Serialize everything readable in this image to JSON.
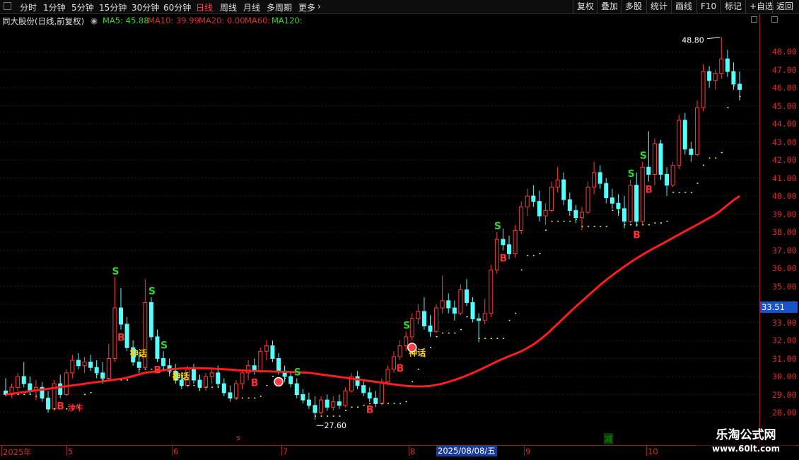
{
  "toolbar": {
    "periods": [
      "分时",
      "1分钟",
      "5分钟",
      "15分钟",
      "30分钟",
      "60分钟",
      "日线",
      "周线",
      "月线",
      "多周期",
      "更多"
    ],
    "active_period": "日线",
    "tools": [
      "复权",
      "叠加",
      "多股",
      "统计",
      "画线",
      "F10",
      "标记",
      "+自选",
      "返回"
    ]
  },
  "info": {
    "stock": "同大股份(日线,前复权)",
    "ma": [
      {
        "label": "MA5: 45.88",
        "color": "#2fd42f"
      },
      {
        "label": "MA10: 39.99",
        "color": "#dd2b2b"
      },
      {
        "label": "MA20: 0.00",
        "color": "#dd2b2b"
      },
      {
        "label": "MA60:",
        "color": "#dd2b2b"
      },
      {
        "label": "MA120:",
        "color": "#2fd42f"
      }
    ]
  },
  "price_tag": "33.51",
  "dates": {
    "ticks": [
      {
        "label": "2025年",
        "x": 4
      },
      {
        "label": "5",
        "x": 96
      },
      {
        "label": "6",
        "x": 245
      },
      {
        "label": "7",
        "x": 400
      },
      {
        "label": "8",
        "x": 580
      },
      {
        "label": "9",
        "x": 743
      },
      {
        "label": "10",
        "x": 916
      }
    ],
    "cursor": "2025/08/08/五",
    "marker_s": "s",
    "marker_jian": "减"
  },
  "watermark": {
    "line1": "乐淘公式网",
    "line2": "www.60lt.com"
  },
  "colors": {
    "up": "#ff3b3b",
    "down": "#54ffff",
    "ma_line": "#ff1c1c",
    "dots": "#ffff40",
    "buy": "#ff3030",
    "sell": "#2fd42f",
    "myth": "#ffd400"
  },
  "chart_data": {
    "type": "candlestick",
    "ylim": [
      27.5,
      49.0
    ],
    "yticks": [
      28,
      29,
      30,
      31,
      32,
      33,
      34,
      35,
      36,
      37,
      38,
      39,
      40,
      41,
      42,
      43,
      44,
      45,
      46,
      47,
      48
    ],
    "annotations": {
      "high_label": "48.80",
      "low_label": "27.60",
      "buy_label": "B",
      "sell_label": "S",
      "myth_label": "神话",
      "ref_label": "涉牛"
    },
    "candles": [
      {
        "o": 29.2,
        "h": 29.9,
        "l": 28.9,
        "c": 29.0
      },
      {
        "o": 29.0,
        "h": 29.6,
        "l": 28.8,
        "c": 29.4
      },
      {
        "o": 29.4,
        "h": 30.2,
        "l": 29.2,
        "c": 30.0
      },
      {
        "o": 30.0,
        "h": 30.8,
        "l": 29.4,
        "c": 29.6
      },
      {
        "o": 29.6,
        "h": 30.0,
        "l": 29.0,
        "c": 29.2
      },
      {
        "o": 29.2,
        "h": 29.8,
        "l": 28.7,
        "c": 29.4
      },
      {
        "o": 29.4,
        "h": 29.7,
        "l": 28.6,
        "c": 28.8
      },
      {
        "o": 28.8,
        "h": 29.2,
        "l": 28.0,
        "c": 28.2
      },
      {
        "o": 28.2,
        "h": 29.8,
        "l": 28.1,
        "c": 29.6
      },
      {
        "o": 29.6,
        "h": 30.1,
        "l": 28.8,
        "c": 29.0
      },
      {
        "o": 29.0,
        "h": 30.4,
        "l": 28.9,
        "c": 30.2
      },
      {
        "o": 30.2,
        "h": 31.2,
        "l": 29.9,
        "c": 30.9
      },
      {
        "o": 30.9,
        "h": 31.3,
        "l": 30.4,
        "c": 30.6
      },
      {
        "o": 30.6,
        "h": 31.1,
        "l": 30.2,
        "c": 30.8
      },
      {
        "o": 30.8,
        "h": 31.2,
        "l": 30.3,
        "c": 30.5
      },
      {
        "o": 30.5,
        "h": 30.9,
        "l": 29.9,
        "c": 30.2
      },
      {
        "o": 30.2,
        "h": 30.8,
        "l": 29.6,
        "c": 29.9
      },
      {
        "o": 29.9,
        "h": 31.8,
        "l": 29.8,
        "c": 31.0
      },
      {
        "o": 31.0,
        "h": 35.5,
        "l": 30.8,
        "c": 33.8
      },
      {
        "o": 33.8,
        "h": 34.9,
        "l": 32.6,
        "c": 32.9
      },
      {
        "o": 32.9,
        "h": 33.3,
        "l": 31.4,
        "c": 31.6
      },
      {
        "o": 31.6,
        "h": 32.0,
        "l": 30.6,
        "c": 30.8
      },
      {
        "o": 30.8,
        "h": 31.3,
        "l": 30.2,
        "c": 30.5
      },
      {
        "o": 30.5,
        "h": 35.4,
        "l": 30.4,
        "c": 34.1
      },
      {
        "o": 34.1,
        "h": 34.4,
        "l": 32.0,
        "c": 32.2
      },
      {
        "o": 32.2,
        "h": 32.6,
        "l": 30.8,
        "c": 31.0
      },
      {
        "o": 31.0,
        "h": 31.4,
        "l": 30.3,
        "c": 30.6
      },
      {
        "o": 30.6,
        "h": 31.0,
        "l": 30.0,
        "c": 30.3
      },
      {
        "o": 30.3,
        "h": 30.7,
        "l": 29.6,
        "c": 29.8
      },
      {
        "o": 29.8,
        "h": 30.2,
        "l": 29.3,
        "c": 29.5
      },
      {
        "o": 29.5,
        "h": 30.6,
        "l": 29.4,
        "c": 30.4
      },
      {
        "o": 30.4,
        "h": 30.7,
        "l": 29.6,
        "c": 29.8
      },
      {
        "o": 29.8,
        "h": 30.1,
        "l": 29.2,
        "c": 29.4
      },
      {
        "o": 29.4,
        "h": 30.2,
        "l": 29.2,
        "c": 30.0
      },
      {
        "o": 30.0,
        "h": 30.5,
        "l": 29.6,
        "c": 30.2
      },
      {
        "o": 30.2,
        "h": 30.6,
        "l": 29.4,
        "c": 29.6
      },
      {
        "o": 29.6,
        "h": 29.9,
        "l": 28.9,
        "c": 29.1
      },
      {
        "o": 29.1,
        "h": 29.5,
        "l": 28.6,
        "c": 28.8
      },
      {
        "o": 28.8,
        "h": 29.8,
        "l": 28.7,
        "c": 29.6
      },
      {
        "o": 29.6,
        "h": 30.4,
        "l": 29.3,
        "c": 30.2
      },
      {
        "o": 30.2,
        "h": 30.9,
        "l": 29.8,
        "c": 30.6
      },
      {
        "o": 30.6,
        "h": 31.0,
        "l": 30.1,
        "c": 30.3
      },
      {
        "o": 30.3,
        "h": 31.6,
        "l": 30.2,
        "c": 31.4
      },
      {
        "o": 31.4,
        "h": 32.0,
        "l": 30.9,
        "c": 31.7
      },
      {
        "o": 31.7,
        "h": 32.0,
        "l": 30.8,
        "c": 31.0
      },
      {
        "o": 31.0,
        "h": 31.3,
        "l": 30.1,
        "c": 30.3
      },
      {
        "o": 30.3,
        "h": 30.6,
        "l": 29.7,
        "c": 30.0
      },
      {
        "o": 30.0,
        "h": 30.3,
        "l": 29.4,
        "c": 29.6
      },
      {
        "o": 29.6,
        "h": 29.9,
        "l": 28.8,
        "c": 29.0
      },
      {
        "o": 29.0,
        "h": 29.3,
        "l": 28.5,
        "c": 28.7
      },
      {
        "o": 28.7,
        "h": 29.1,
        "l": 28.2,
        "c": 28.4
      },
      {
        "o": 28.4,
        "h": 28.9,
        "l": 27.6,
        "c": 28.0
      },
      {
        "o": 28.0,
        "h": 28.9,
        "l": 27.9,
        "c": 28.7
      },
      {
        "o": 28.7,
        "h": 29.0,
        "l": 28.1,
        "c": 28.3
      },
      {
        "o": 28.3,
        "h": 28.9,
        "l": 28.1,
        "c": 28.6
      },
      {
        "o": 28.6,
        "h": 29.0,
        "l": 28.2,
        "c": 28.4
      },
      {
        "o": 28.4,
        "h": 29.4,
        "l": 28.3,
        "c": 29.2
      },
      {
        "o": 29.2,
        "h": 30.2,
        "l": 29.1,
        "c": 30.0
      },
      {
        "o": 30.0,
        "h": 30.3,
        "l": 29.3,
        "c": 29.5
      },
      {
        "o": 29.5,
        "h": 29.8,
        "l": 28.9,
        "c": 29.1
      },
      {
        "o": 29.1,
        "h": 29.4,
        "l": 28.6,
        "c": 28.8
      },
      {
        "o": 28.8,
        "h": 29.2,
        "l": 28.3,
        "c": 28.5
      },
      {
        "o": 28.5,
        "h": 29.9,
        "l": 28.4,
        "c": 29.7
      },
      {
        "o": 29.7,
        "h": 30.6,
        "l": 29.5,
        "c": 30.4
      },
      {
        "o": 30.4,
        "h": 31.4,
        "l": 30.2,
        "c": 31.1
      },
      {
        "o": 31.1,
        "h": 32.0,
        "l": 30.9,
        "c": 31.7
      },
      {
        "o": 31.7,
        "h": 32.5,
        "l": 31.4,
        "c": 32.2
      },
      {
        "o": 32.2,
        "h": 33.5,
        "l": 32.0,
        "c": 33.2
      },
      {
        "o": 33.2,
        "h": 34.0,
        "l": 32.9,
        "c": 33.6
      },
      {
        "o": 33.6,
        "h": 34.4,
        "l": 32.6,
        "c": 32.8
      },
      {
        "o": 32.8,
        "h": 33.4,
        "l": 32.2,
        "c": 32.5
      },
      {
        "o": 32.5,
        "h": 34.0,
        "l": 32.4,
        "c": 33.8
      },
      {
        "o": 33.8,
        "h": 35.6,
        "l": 33.5,
        "c": 34.2
      },
      {
        "o": 34.2,
        "h": 34.6,
        "l": 33.5,
        "c": 33.8
      },
      {
        "o": 33.8,
        "h": 34.2,
        "l": 33.1,
        "c": 33.5
      },
      {
        "o": 33.5,
        "h": 35.1,
        "l": 33.4,
        "c": 34.8
      },
      {
        "o": 34.8,
        "h": 35.4,
        "l": 33.9,
        "c": 34.1
      },
      {
        "o": 34.1,
        "h": 34.4,
        "l": 33.0,
        "c": 33.2
      },
      {
        "o": 33.2,
        "h": 33.5,
        "l": 31.9,
        "c": 33.1
      },
      {
        "o": 33.1,
        "h": 34.3,
        "l": 32.9,
        "c": 33.5
      },
      {
        "o": 33.5,
        "h": 36.2,
        "l": 33.3,
        "c": 35.9
      },
      {
        "o": 35.9,
        "h": 38.0,
        "l": 35.7,
        "c": 37.6
      },
      {
        "o": 37.6,
        "h": 38.2,
        "l": 37.0,
        "c": 37.3
      },
      {
        "o": 37.3,
        "h": 37.8,
        "l": 36.5,
        "c": 36.8
      },
      {
        "o": 36.8,
        "h": 38.4,
        "l": 36.6,
        "c": 38.1
      },
      {
        "o": 38.1,
        "h": 39.7,
        "l": 37.9,
        "c": 39.4
      },
      {
        "o": 39.4,
        "h": 40.4,
        "l": 38.9,
        "c": 40.0
      },
      {
        "o": 40.0,
        "h": 40.6,
        "l": 39.4,
        "c": 39.7
      },
      {
        "o": 39.7,
        "h": 40.3,
        "l": 38.6,
        "c": 38.9
      },
      {
        "o": 38.9,
        "h": 39.6,
        "l": 38.4,
        "c": 39.2
      },
      {
        "o": 39.2,
        "h": 40.8,
        "l": 39.1,
        "c": 40.5
      },
      {
        "o": 40.5,
        "h": 41.6,
        "l": 40.2,
        "c": 40.9
      },
      {
        "o": 40.9,
        "h": 41.3,
        "l": 39.5,
        "c": 39.8
      },
      {
        "o": 39.8,
        "h": 40.2,
        "l": 38.9,
        "c": 39.2
      },
      {
        "o": 39.2,
        "h": 39.5,
        "l": 38.5,
        "c": 38.8
      },
      {
        "o": 38.8,
        "h": 39.4,
        "l": 38.1,
        "c": 39.1
      },
      {
        "o": 39.1,
        "h": 40.8,
        "l": 39.0,
        "c": 40.5
      },
      {
        "o": 40.5,
        "h": 41.9,
        "l": 40.1,
        "c": 41.3
      },
      {
        "o": 41.3,
        "h": 41.7,
        "l": 40.4,
        "c": 40.7
      },
      {
        "o": 40.7,
        "h": 41.0,
        "l": 39.6,
        "c": 39.9
      },
      {
        "o": 39.9,
        "h": 40.4,
        "l": 39.3,
        "c": 39.6
      },
      {
        "o": 39.6,
        "h": 40.1,
        "l": 38.9,
        "c": 39.3
      },
      {
        "o": 39.3,
        "h": 40.0,
        "l": 38.2,
        "c": 38.6
      },
      {
        "o": 38.6,
        "h": 40.9,
        "l": 38.5,
        "c": 40.6
      },
      {
        "o": 40.6,
        "h": 41.3,
        "l": 38.3,
        "c": 38.6
      },
      {
        "o": 38.6,
        "h": 41.9,
        "l": 38.4,
        "c": 41.6
      },
      {
        "o": 41.6,
        "h": 43.6,
        "l": 40.8,
        "c": 41.2
      },
      {
        "o": 41.2,
        "h": 43.2,
        "l": 40.6,
        "c": 42.9
      },
      {
        "o": 42.9,
        "h": 43.1,
        "l": 40.9,
        "c": 41.2
      },
      {
        "o": 41.2,
        "h": 41.6,
        "l": 40.0,
        "c": 40.6
      },
      {
        "o": 40.6,
        "h": 41.9,
        "l": 40.5,
        "c": 41.7
      },
      {
        "o": 41.7,
        "h": 44.5,
        "l": 41.5,
        "c": 44.2
      },
      {
        "o": 44.2,
        "h": 44.6,
        "l": 42.3,
        "c": 42.6
      },
      {
        "o": 42.6,
        "h": 43.0,
        "l": 41.9,
        "c": 42.3
      },
      {
        "o": 42.3,
        "h": 45.3,
        "l": 42.2,
        "c": 44.9
      },
      {
        "o": 44.9,
        "h": 47.3,
        "l": 44.7,
        "c": 46.9
      },
      {
        "o": 46.9,
        "h": 47.2,
        "l": 46.0,
        "c": 46.4
      },
      {
        "o": 46.4,
        "h": 47.0,
        "l": 45.9,
        "c": 46.8
      },
      {
        "o": 46.8,
        "h": 48.8,
        "l": 46.5,
        "c": 47.6
      },
      {
        "o": 47.6,
        "h": 48.1,
        "l": 46.6,
        "c": 46.9
      },
      {
        "o": 46.9,
        "h": 47.4,
        "l": 45.9,
        "c": 46.2
      },
      {
        "o": 46.2,
        "h": 46.9,
        "l": 45.3,
        "c": 45.9
      }
    ],
    "ma_line": [
      29.0,
      29.05,
      29.1,
      29.15,
      29.2,
      29.25,
      29.3,
      29.35,
      29.4,
      29.45,
      29.5,
      29.55,
      29.6,
      29.65,
      29.7,
      29.75,
      29.8,
      29.85,
      29.9,
      30.0,
      30.1,
      30.2,
      30.25,
      30.3,
      30.35,
      30.4,
      30.43,
      30.45,
      30.46,
      30.46,
      30.45,
      30.44,
      30.42,
      30.4,
      30.38,
      30.35,
      30.33,
      30.31,
      30.3,
      30.29,
      30.28,
      30.27,
      30.26,
      30.25,
      30.24,
      30.22,
      30.2,
      30.15,
      30.1,
      30.05,
      30.0,
      29.95,
      29.9,
      29.85,
      29.8,
      29.75,
      29.7,
      29.65,
      29.6,
      29.55,
      29.5,
      29.47,
      29.45,
      29.45,
      29.47,
      29.52,
      29.6,
      29.7,
      29.82,
      29.95,
      30.1,
      30.25,
      30.42,
      30.6,
      30.78,
      30.95,
      31.1,
      31.25,
      31.4,
      31.6,
      31.82,
      32.1,
      32.4,
      32.75,
      33.1,
      33.45,
      33.8,
      34.12,
      34.45,
      34.78,
      35.1,
      35.4,
      35.68,
      35.95,
      36.2,
      36.45,
      36.68,
      36.9,
      37.1,
      37.3,
      37.5,
      37.7,
      37.9,
      38.1,
      38.3,
      38.5,
      38.7,
      38.9,
      39.15,
      39.45,
      39.75,
      40.0
    ]
  }
}
